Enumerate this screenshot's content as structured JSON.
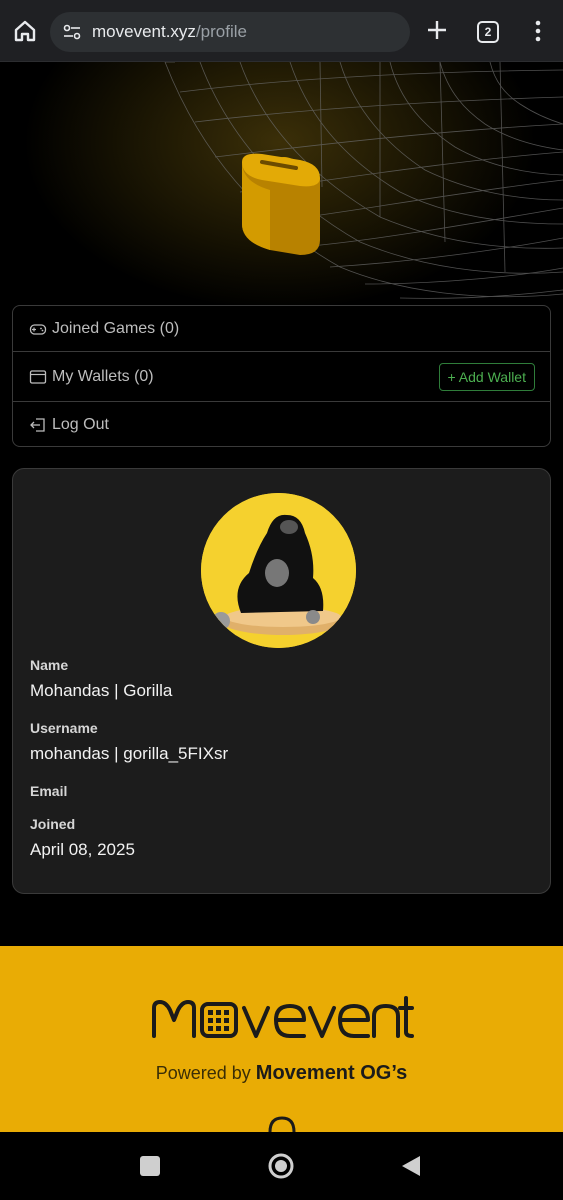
{
  "browser": {
    "url_host": "movevent.xyz",
    "url_path": "/profile",
    "tab_count": "2"
  },
  "menu": {
    "joined_games": "Joined Games (0)",
    "my_wallets": "My Wallets (0)",
    "add_wallet": "+ Add Wallet",
    "log_out": "Log Out"
  },
  "profile": {
    "name_label": "Name",
    "name_value": "Mohandas | Gorilla",
    "username_label": "Username",
    "username_value": "mohandas | gorilla_5FIXsr",
    "email_label": "Email",
    "joined_label": "Joined",
    "joined_value": "April 08, 2025"
  },
  "footer": {
    "brand": "Movevent",
    "powered_prefix": "Powered by",
    "powered_brand": "Movement OG’s"
  },
  "colors": {
    "accent_yellow": "#e9ac05",
    "add_wallet_green": "#4caf50",
    "card_bg": "#1c1c1c"
  },
  "icons": [
    "home-icon",
    "site-settings-icon",
    "plus-icon",
    "tabs-icon",
    "more-vert-icon",
    "gamepad-icon",
    "wallet-icon",
    "logout-icon",
    "square-icon",
    "circle-home-icon",
    "back-triangle-icon"
  ]
}
